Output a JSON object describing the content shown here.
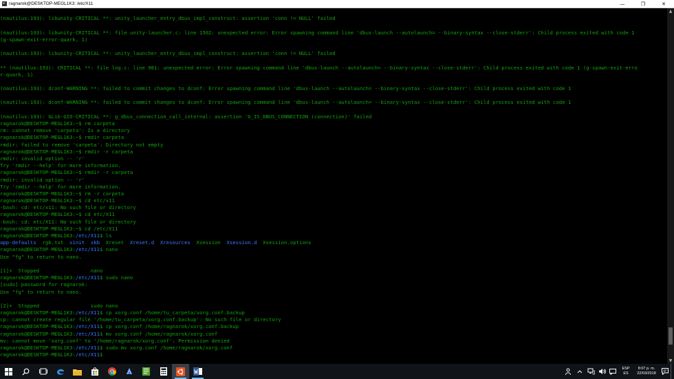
{
  "window": {
    "title": "ragnarok@DESKTOP-MEGL1K3: /etc/X11",
    "minimize_glyph": "—",
    "maximize_glyph": "❐",
    "close_glyph": "✕"
  },
  "terminal": {
    "fg_color": "#13a10e",
    "dir_color": "#3b78ff",
    "lines": [
      [],
      [
        {
          "t": "(nautilus:193): libunity-CRITICAL **: unity_launcher_entry_dbus_impl_construct: assertion 'conn != NULL' failed"
        }
      ],
      [],
      [
        {
          "t": "(nautilus:193): libunity-CRITICAL **: file unity-launcher.c: line 1502: unexpected error: Error spawning command line 'dbus-launch --autolaunch= --binary-syntax --close-stderr': Child process exited with code 1"
        }
      ],
      [
        {
          "t": "(g-spawn-exit-error-quark, 1)"
        }
      ],
      [],
      [
        {
          "t": "(nautilus:193): libunity-CRITICAL **: unity_launcher_entry_dbus_impl_construct: assertion 'conn != NULL' failed"
        }
      ],
      [],
      [
        {
          "t": "** (nautilus:193): CRITICAL **: file log.c: line 981: unexpected error: Error spawning command line 'dbus-launch --autolaunch= --binary-syntax --close-stderr': Child process exited with code 1 (g-spawn-exit-erro"
        }
      ],
      [
        {
          "t": "r-quark, 1)"
        }
      ],
      [],
      [
        {
          "t": "(nautilus:193): dconf-WARNING **: failed to commit changes to dconf: Error spawning command line 'dbus-launch --autolaunch= --binary-syntax --close-stderr': Child process exited with code 1"
        }
      ],
      [],
      [
        {
          "t": "(nautilus:193): dconf-WARNING **: failed to commit changes to dconf: Error spawning command line 'dbus-launch --autolaunch= --binary-syntax --close-stderr': Child process exited with code 1"
        }
      ],
      [],
      [
        {
          "t": "(nautilus:193): GLib-GIO-CRITICAL **: g_dbus_connection_call_internal: assertion 'G_IS_DBUS_CONNECTION (connection)' failed"
        }
      ],
      [
        {
          "t": "ragnarok@DESKTOP-MEGL1K3:~$ rm carpeta"
        }
      ],
      [
        {
          "t": "rm: cannot remove 'carpeta': Is a directory"
        }
      ],
      [
        {
          "t": "ragnarok@DESKTOP-MEGL1K3:~$ rmdir carpeta"
        }
      ],
      [
        {
          "t": "rmdir: failed to remove 'carpeta': Directory not empty"
        }
      ],
      [
        {
          "t": "ragnarok@DESKTOP-MEGL1K3:~$ rmdir -r carpeta"
        }
      ],
      [
        {
          "t": "rmdir: invalid option -- 'r'"
        }
      ],
      [
        {
          "t": "Try 'rmdir --help' for more information."
        }
      ],
      [
        {
          "t": "ragnarok@DESKTOP-MEGL1K3:~$ rmdir -r carpeta"
        }
      ],
      [
        {
          "t": "rmdir: invalid option -- 'r'"
        }
      ],
      [
        {
          "t": "Try 'rmdir --help' for more information."
        }
      ],
      [
        {
          "t": "ragnarok@DESKTOP-MEGL1K3:~$ rm -r carpeta"
        }
      ],
      [
        {
          "t": "ragnarok@DESKTOP-MEGL1K3:~$ cd etc/x11"
        }
      ],
      [
        {
          "t": "-bash: cd: etc/x11: No such file or directory"
        }
      ],
      [
        {
          "t": "ragnarok@DESKTOP-MEGL1K3:~$ cd etc/X11"
        }
      ],
      [
        {
          "t": "-bash: cd: etc/X11: No such file or directory"
        }
      ],
      [
        {
          "t": "ragnarok@DESKTOP-MEGL1K3:~$ cd /etc/X11"
        }
      ],
      [
        {
          "t": "ragnarok@DESKTOP-MEGL1K3:"
        },
        {
          "t": "/etc/X11",
          "c": "d"
        },
        {
          "t": "$ ls"
        }
      ],
      [
        {
          "t": "app-defaults",
          "c": "d"
        },
        {
          "t": "  rgb.txt  "
        },
        {
          "t": "xinit",
          "c": "d"
        },
        {
          "t": "  "
        },
        {
          "t": "xkb",
          "c": "d"
        },
        {
          "t": "  Xreset  "
        },
        {
          "t": "Xreset.d",
          "c": "d"
        },
        {
          "t": "  "
        },
        {
          "t": "Xresources",
          "c": "d"
        },
        {
          "t": "  Xsession  "
        },
        {
          "t": "Xsession.d",
          "c": "d"
        },
        {
          "t": "  Xsession.options"
        }
      ],
      [
        {
          "t": "ragnarok@DESKTOP-MEGL1K3:"
        },
        {
          "t": "/etc/X11",
          "c": "d"
        },
        {
          "t": "$ nano"
        }
      ],
      [
        {
          "t": "Use \"fg\" to return to nano."
        }
      ],
      [],
      [
        {
          "t": "[1]+  Stopped                 nano"
        }
      ],
      [
        {
          "t": "ragnarok@DESKTOP-MEGL1K3:"
        },
        {
          "t": "/etc/X11",
          "c": "d"
        },
        {
          "t": "$ sudo nano"
        }
      ],
      [
        {
          "t": "[sudo] password for ragnarok:"
        }
      ],
      [
        {
          "t": "Use \"fg\" to return to nano."
        }
      ],
      [],
      [
        {
          "t": "[2]+  Stopped                 sudo nano"
        }
      ],
      [
        {
          "t": "ragnarok@DESKTOP-MEGL1K3:"
        },
        {
          "t": "/etc/X11",
          "c": "d"
        },
        {
          "t": "$ cp xorg.conf /home/tu_carpeta/xorg.conf.backup"
        }
      ],
      [
        {
          "t": "cp: cannot create regular file '/home/tu_carpeta/xorg.conf.backup': No such file or directory"
        }
      ],
      [
        {
          "t": "ragnarok@DESKTOP-MEGL1K3:"
        },
        {
          "t": "/etc/X11",
          "c": "d"
        },
        {
          "t": "$ cp xorg.conf /home/ragnarok/xorg.conf.backup"
        }
      ],
      [
        {
          "t": "ragnarok@DESKTOP-MEGL1K3:"
        },
        {
          "t": "/etc/X11",
          "c": "d"
        },
        {
          "t": "$ mv xorg.conf /home/ragnarok/xorg.conf"
        }
      ],
      [
        {
          "t": "mv: cannot move 'xorg.conf' to '/home/ragnarok/xorg.conf': Permission denied"
        }
      ],
      [
        {
          "t": "ragnarok@DESKTOP-MEGL1K3:"
        },
        {
          "t": "/etc/X11",
          "c": "d"
        },
        {
          "t": "$ sudo mv xorg.conf /home/ragnarok/xorg.conf"
        }
      ],
      [
        {
          "t": "ragnarok@DESKTOP-MEGL1K3:"
        },
        {
          "t": "/etc/X11",
          "c": "d"
        },
        {
          "t": "$"
        }
      ]
    ]
  },
  "scrollbar": {
    "position_fraction": 0.96,
    "visible_fraction": 0.05
  },
  "taskbar": {
    "buttons": [
      {
        "name": "start-button",
        "icon": "windows-icon"
      },
      {
        "name": "search-button",
        "icon": "search-icon"
      },
      {
        "name": "task-view-button",
        "icon": "task-view-icon"
      },
      {
        "name": "edge-button",
        "icon": "edge-icon"
      },
      {
        "name": "file-explorer-button",
        "icon": "folder-icon"
      },
      {
        "name": "store-button",
        "icon": "store-icon"
      },
      {
        "name": "chrome-button",
        "icon": "chrome-icon"
      },
      {
        "name": "app-button",
        "icon": "blue-app-icon"
      },
      {
        "name": "notepad-button",
        "icon": "notepad-icon"
      },
      {
        "name": "calculator-button",
        "icon": "calculator-icon"
      },
      {
        "name": "ubuntu-button",
        "icon": "ubuntu-icon",
        "active": true
      },
      {
        "name": "word-button",
        "icon": "word-icon",
        "open": true
      }
    ],
    "tray": {
      "language_top": "ESP",
      "language_bottom": "ES",
      "time": "8:07 p. m.",
      "date": "22/03/2018"
    }
  }
}
